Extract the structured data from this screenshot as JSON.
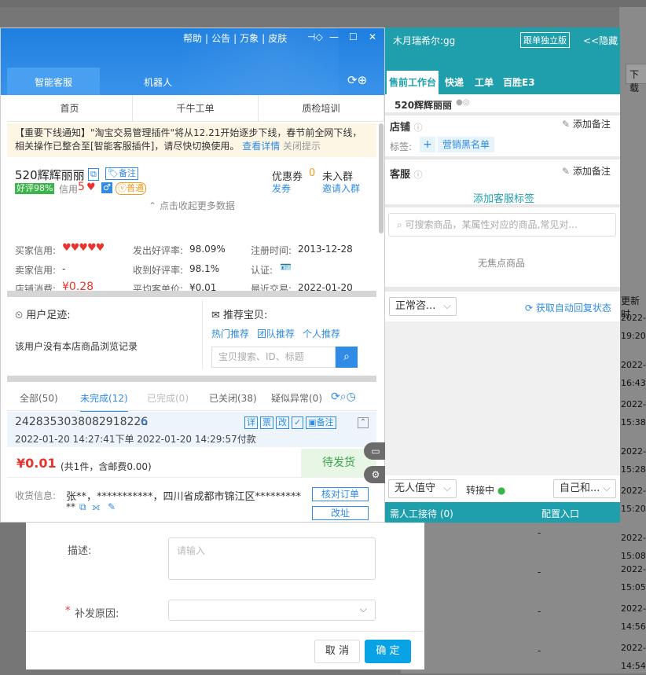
{
  "background": {
    "download_label": "下载",
    "update_label": "更新时",
    "dates": [
      [
        "2022-",
        "19:20:"
      ],
      [
        "2022-",
        "16:43:"
      ],
      [
        "2022-",
        "15:38:"
      ],
      [
        "2022-",
        "15:28:"
      ],
      [
        "2022-",
        "15:20:"
      ],
      [
        "2022-",
        "15:08:"
      ],
      [
        "2022-",
        "15:05:"
      ],
      [
        "2022-",
        "14:56:"
      ],
      [
        "2022-",
        "14:54:"
      ]
    ],
    "dash": "-"
  },
  "dialog": {
    "desc_label": "描述:",
    "desc_placeholder": "请输入",
    "reason_required": "*",
    "reason_label": "补发原因:",
    "cancel": "取 消",
    "confirm": "确 定"
  },
  "left_panel": {
    "menu": [
      "帮助",
      "公告",
      "万象",
      "皮肤"
    ],
    "tabs": [
      "智能客服",
      "机器人"
    ],
    "nav": [
      "首页",
      "千牛工单",
      "质检培训"
    ],
    "notice": {
      "text": "【重要下线通知】\"淘宝交易管理插件\"将从12.21开始逐步下线，春节前全网下线，相关操作已整合至[智能客服插件]，请尽快切换使用。",
      "link": "查看详情",
      "close": "关闭提示"
    },
    "customer": {
      "nick": "520辉辉丽丽",
      "note_badge": "备注",
      "good_rate": "好评98%",
      "credit_label": "信用",
      "credit_value": "5",
      "level": "普通",
      "coupon_label": "优惠券",
      "coupon_count": "0",
      "coupon_action": "发券",
      "group_status": "未入群",
      "group_action": "邀请入群",
      "expand": "点击收起更多数据",
      "rows": [
        [
          {
            "k": "买家信用:",
            "v": "♥♥♥♥♥"
          },
          {
            "k": "发出好评率:",
            "v": "98.09%"
          },
          {
            "k": "注册时间:",
            "v": "2013-12-28"
          }
        ],
        [
          {
            "k": "卖家信用:",
            "v": "-"
          },
          {
            "k": "收到好评率:",
            "v": "98.1%"
          },
          {
            "k": "认证:",
            "v": ""
          }
        ],
        [
          {
            "k": "店铺消费:",
            "v": "¥0.28"
          },
          {
            "k": "平均客单价:",
            "v": "¥0.01"
          },
          {
            "k": "最近交易:",
            "v": "2022-01-20"
          }
        ]
      ]
    },
    "footprint": {
      "title": "用户足迹:",
      "empty": "该用户没有本店商品浏览记录"
    },
    "recommend": {
      "title": "推荐宝贝:",
      "links": [
        "热门推荐",
        "团队推荐",
        "个人推荐"
      ],
      "search_placeholder": "宝贝搜索、ID、标题"
    },
    "order_tabs": [
      {
        "label": "全部(50)",
        "active": false
      },
      {
        "label": "未完成(12)",
        "active": true
      },
      {
        "label": "已完成(0)",
        "active": false
      },
      {
        "label": "已关闭(38)",
        "active": false
      },
      {
        "label": "疑似异常(0)",
        "active": false
      }
    ],
    "order": {
      "id": "2428353038082918226",
      "actions": [
        "详",
        "票",
        "改",
        "✓"
      ],
      "note_btn": "备注",
      "time": "2022-01-20 14:27:41下单  2022-01-20 14:29:57付款",
      "price": "¥0.01",
      "summary": "(共1件，含邮费0.00)",
      "status": "待发货",
      "address_label": "收货信息:",
      "address": "张**，***********，四川省成都市锦江区*********",
      "address_tail": "**",
      "check_btn": "核对订单",
      "edit_btn": "改址"
    }
  },
  "right_panel": {
    "title": "木月瑞希尔:gg",
    "independent": "跟单独立版",
    "hide": "<<隐藏",
    "tabs": [
      "售前工作台",
      "快递",
      "工单",
      "百胜E3"
    ],
    "nick": "520辉辉丽丽",
    "shop_label": "店铺",
    "add_note": "添加备注",
    "tag_label": "标签:",
    "tag": "营销黑名单",
    "service_label": "客服",
    "add_service_tag": "添加客服标签",
    "search_placeholder": "可搜索商品，某属性对应的商品,常见对...",
    "no_focus": "无焦点商品",
    "consult_select": "正常咨...",
    "auto_reply": "获取自动回复状态",
    "duty_select": "无人值守",
    "transfer": "转接中",
    "self_select": "自己和...",
    "need_manual": "需人工接待 (0)",
    "config_entry": "配置入口"
  }
}
